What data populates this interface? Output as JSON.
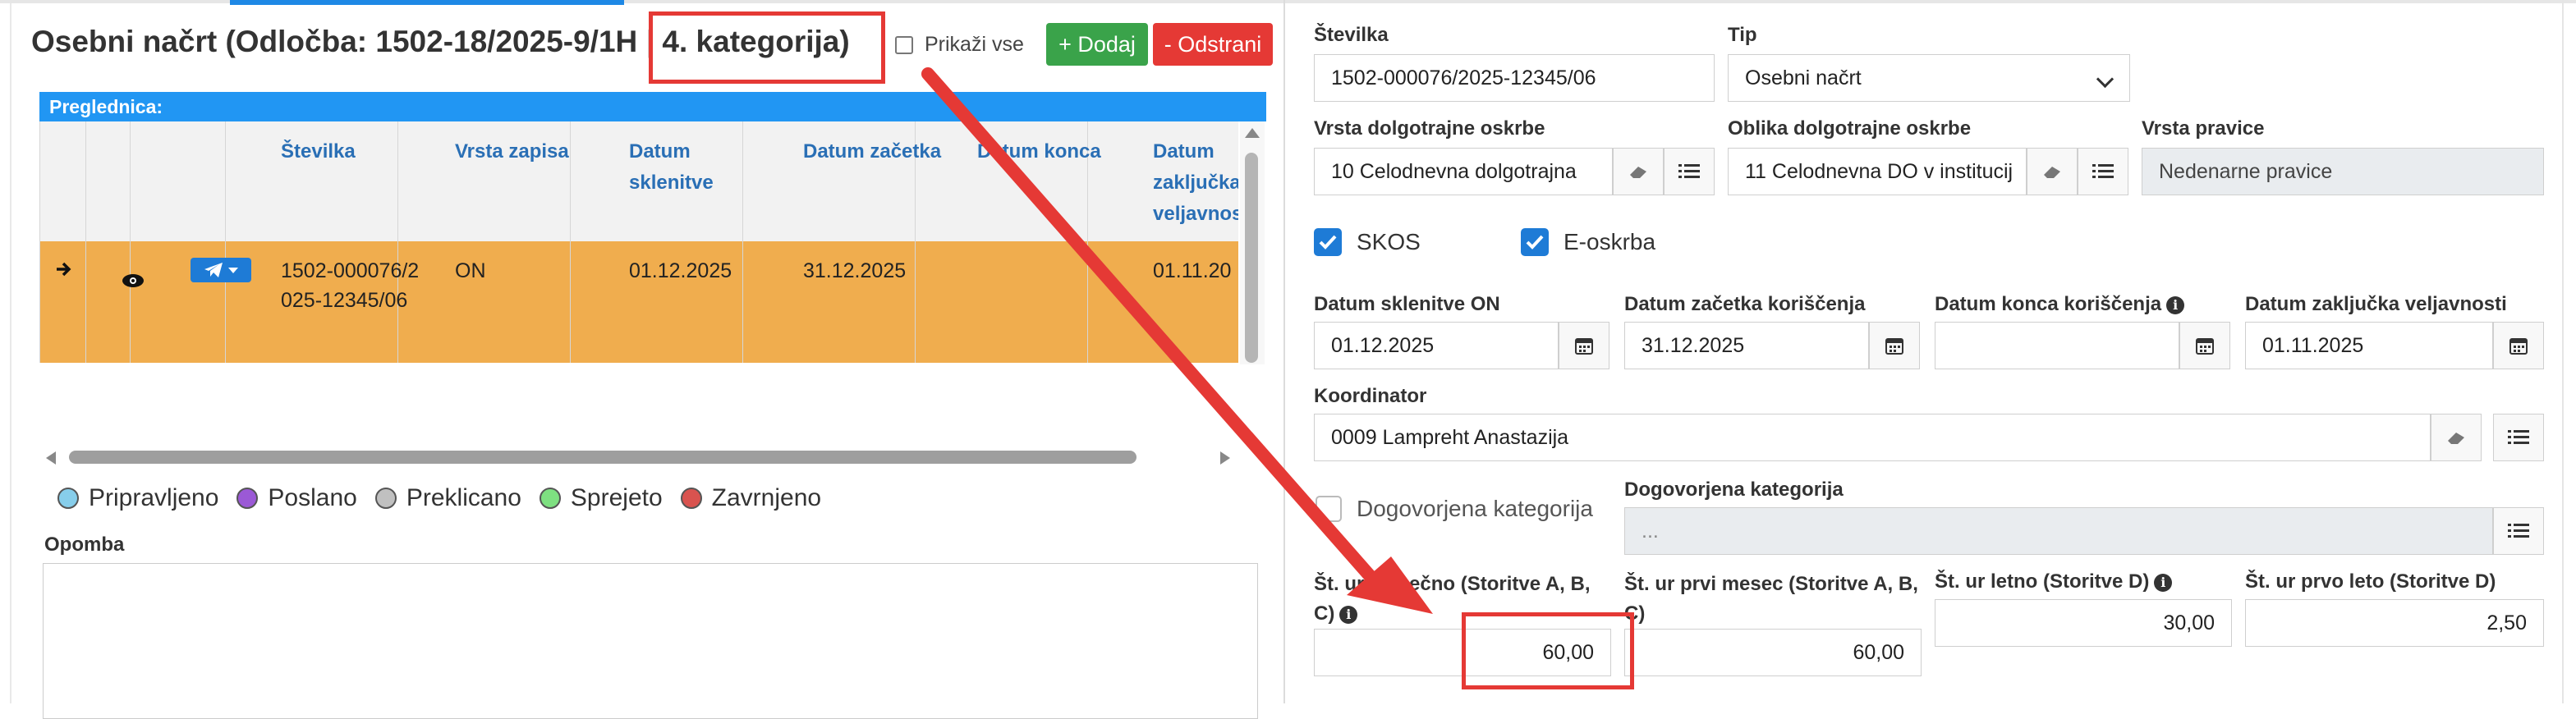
{
  "left": {
    "title_main": "Osebni načrt (Odločba: 1502-18/2025-9/1H",
    "title_sep": " | ",
    "title_category": "4. kategorija)",
    "show_all_label": "Prikaži vse",
    "add_label": "+ Dodaj",
    "delete_label": "- Odstrani",
    "grid_title": "Preglednica:",
    "columns": [
      "Številka",
      "Vrsta zapisa",
      "Datum sklenitve",
      "Datum začetka",
      "Datum konca",
      "Datum zaključka veljavnosti"
    ],
    "row": {
      "stevilka": "1502-000076/2025-12345/06",
      "vrsta_zapisa": "ON",
      "datum_sklenitve": "01.12.2025",
      "datum_zacetka": "31.12.2025",
      "datum_konca": "",
      "datum_zakljucka": "01.11.20"
    },
    "legend": [
      {
        "label": "Pripravljeno",
        "color": "#87ceeb"
      },
      {
        "label": "Poslano",
        "color": "#9b59d6"
      },
      {
        "label": "Preklicano",
        "color": "#c0c0c0"
      },
      {
        "label": "Sprejeto",
        "color": "#7ee081"
      },
      {
        "label": "Zavrnjeno",
        "color": "#d9534f"
      }
    ],
    "opomba_label": "Opomba"
  },
  "right": {
    "stevilka_label": "Številka",
    "stevilka_value": "1502-000076/2025-12345/06",
    "tip_label": "Tip",
    "tip_value": "Osebni načrt",
    "vrsta_oskrbe_label": "Vrsta dolgotrajne oskrbe",
    "vrsta_oskrbe_value": "10 Celodnevna dolgotrajna",
    "oblika_oskrbe_label": "Oblika dolgotrajne oskrbe",
    "oblika_oskrbe_value": "11 Celodnevna DO v institucij",
    "vrsta_pravice_label": "Vrsta pravice",
    "vrsta_pravice_value": "Nedenarne pravice",
    "skos_label": "SKOS",
    "eoskrba_label": "E-oskrba",
    "datum_sklenitve_label": "Datum sklenitve ON",
    "datum_sklenitve_value": "01.12.2025",
    "datum_zacetka_label": "Datum začetka koriščenja",
    "datum_zacetka_value": "31.12.2025",
    "datum_konca_label": "Datum konca koriščenja",
    "datum_konca_value": "",
    "datum_zakljucka_label": "Datum zaključka veljavnosti",
    "datum_zakljucka_value": "01.11.2025",
    "koordinator_label": "Koordinator",
    "koordinator_value": "0009 Lampreht Anastazija",
    "dogovorjena_chk_label": "Dogovorjena kategorija",
    "dogovorjena_label": "Dogovorjena kategorija",
    "dogovorjena_value": "...",
    "ur_mesecno_label_1": "Št. ur mesečno (Storitve A, B,",
    "ur_mesecno_label_2": "C)",
    "ur_mesecno_value": "60,00",
    "ur_prvi_mesec_label_1": "Št. ur prvi mesec (Storitve A, B,",
    "ur_prvi_mesec_label_2": "C)",
    "ur_prvi_mesec_value": "60,00",
    "ur_letno_label": "Št. ur letno (Storitve D)",
    "ur_letno_value": "30,00",
    "ur_prvo_leto_label": "Št. ur prvo leto (Storitve D)",
    "ur_prvo_leto_value": "2,50"
  },
  "colors": {
    "accent": "#1e88e5",
    "row_highlight": "#f0ad4e",
    "add": "#3aa34a",
    "remove": "#e53935",
    "annotation": "#e53935"
  }
}
